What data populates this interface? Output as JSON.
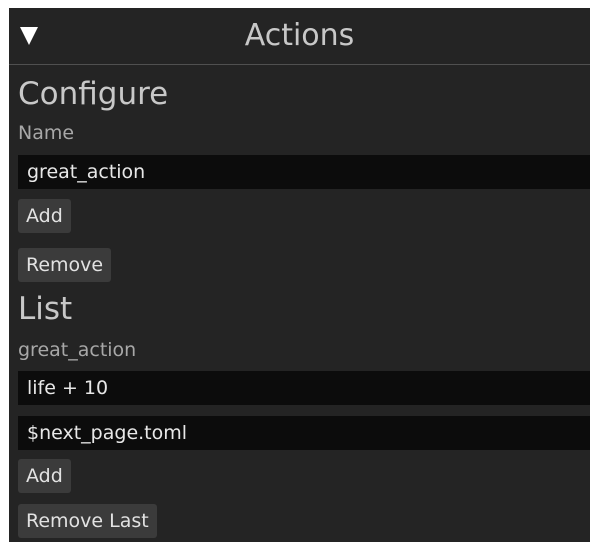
{
  "panel": {
    "title": "Actions",
    "collapse_icon": "triangle-down-icon"
  },
  "configure": {
    "heading": "Configure",
    "name_label": "Name",
    "name_value": "great_action",
    "add_label": "Add",
    "remove_label": "Remove"
  },
  "list": {
    "heading": "List",
    "action_name": "great_action",
    "entries": [
      "life + 10",
      "$next_page.toml"
    ],
    "add_label": "Add",
    "remove_last_label": "Remove Last"
  },
  "colors": {
    "panel_background": "#242424",
    "field_background": "#0c0c0c",
    "button_background": "#3b3b3b"
  }
}
